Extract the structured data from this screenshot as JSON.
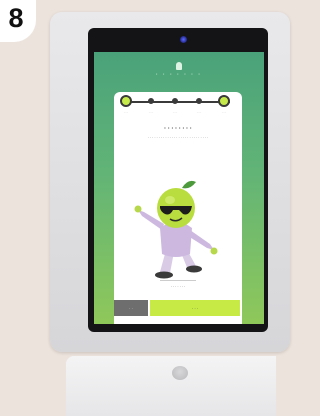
{
  "figure": {
    "label": "8"
  },
  "kiosk": {
    "brand": {
      "name": "· · · · · · ·"
    },
    "card": {
      "steps": [
        {
          "label": "· · ·"
        },
        {
          "label": "· · ·"
        },
        {
          "label": "· · ·"
        },
        {
          "label": "· · ·"
        },
        {
          "label": "· · ·"
        }
      ],
      "title": "· · · · · · · ·",
      "text": "· · · · · · · · · · · · · · · · · · · · · · · · · · · ·",
      "caption": "· · · · · · ·",
      "back_label": "· ·",
      "next_label": "· · ·"
    }
  },
  "colors": {
    "screen_top": "#4aa27a",
    "screen_bottom": "#8fc85a",
    "accent": "#c7ea45"
  }
}
